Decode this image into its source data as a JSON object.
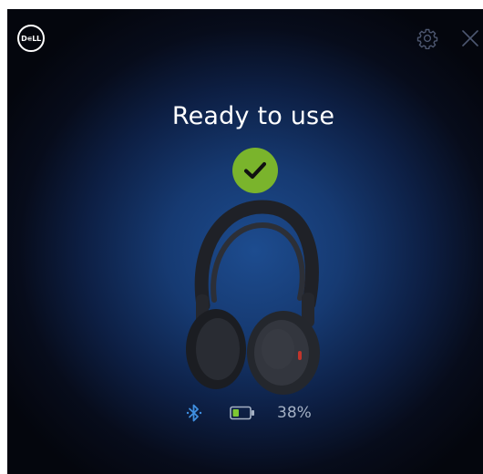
{
  "header": {
    "logo_text": "D∊LL",
    "settings_icon": "gear-icon",
    "close_icon": "close-icon"
  },
  "status": {
    "title": "Ready to use",
    "check_icon": "checkmark-icon",
    "check_color": "#7ab42c"
  },
  "device": {
    "image": "headphones-image",
    "bluetooth_icon": "bluetooth-icon",
    "bluetooth_color": "#3f8fe0",
    "battery_icon": "battery-icon",
    "battery_percent": "38%",
    "battery_level": 0.38,
    "battery_color": "#7ec832"
  }
}
